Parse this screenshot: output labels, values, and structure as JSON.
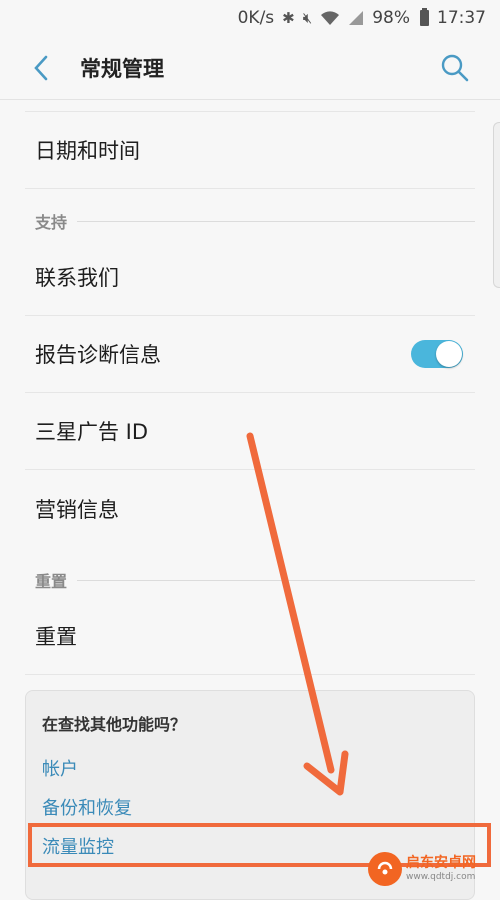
{
  "status_bar": {
    "speed": "0K/s",
    "battery": "98%",
    "time": "17:37",
    "icons": [
      "bluetooth-icon",
      "mute-icon",
      "wifi-icon",
      "signal-icon",
      "battery-icon"
    ]
  },
  "app_bar": {
    "title": "常规管理",
    "back_icon": "chevron-left-icon",
    "search_icon": "search-icon"
  },
  "rows": [
    {
      "label": "日期和时间"
    },
    {
      "label": "联系我们"
    },
    {
      "label": "报告诊断信息",
      "toggle_on": true
    },
    {
      "label": "三星广告 ID"
    },
    {
      "label": "营销信息"
    },
    {
      "label": "重置"
    }
  ],
  "sections": {
    "support": "支持",
    "reset": "重置"
  },
  "card": {
    "title": "在查找其他功能吗？",
    "links": [
      "帐户",
      "备份和恢复",
      "流量监控"
    ]
  },
  "watermark": {
    "name": "启东安卓网",
    "url": "www.qdtdj.com"
  },
  "colors": {
    "accent": "#4ab6dc",
    "link": "#3a8ab8",
    "annotation": "#f06a3c"
  }
}
